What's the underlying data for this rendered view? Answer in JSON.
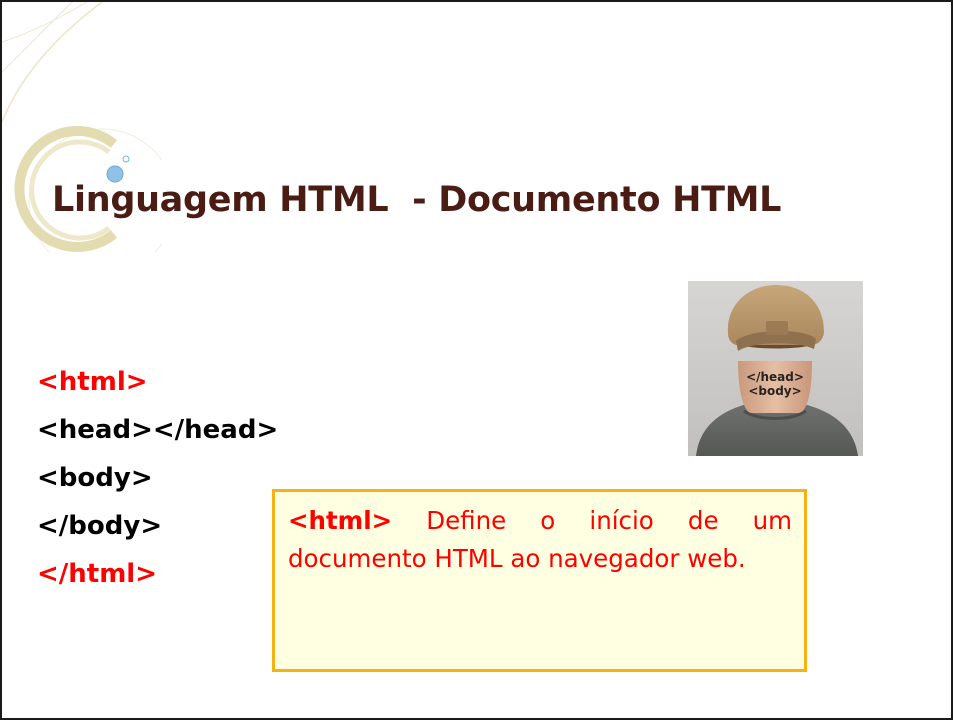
{
  "slide": {
    "title": "Linguagem HTML  - Documento HTML",
    "code_lines": [
      {
        "text": "<html>",
        "color": "#ff0000"
      },
      {
        "text": "<head></head>",
        "color": "#000000"
      },
      {
        "text": "<body>",
        "color": "#000000"
      },
      {
        "text": "</body>",
        "color": "#000000"
      },
      {
        "text": "</html>",
        "color": "#ff0000"
      }
    ],
    "photo": {
      "icon": "neck-tattoo-photo",
      "tattoo_lines": [
        "</head>",
        "<body>"
      ]
    },
    "callout": {
      "tag": "<html>",
      "text": " Define o início de um documento HTML  ao navegador web."
    }
  },
  "colors": {
    "title": "#4a1c14",
    "accent_red": "#ff0000",
    "callout_border": "#f5b212",
    "callout_bg": "#ffffe1",
    "deco_ring": "#e8e3c0"
  }
}
